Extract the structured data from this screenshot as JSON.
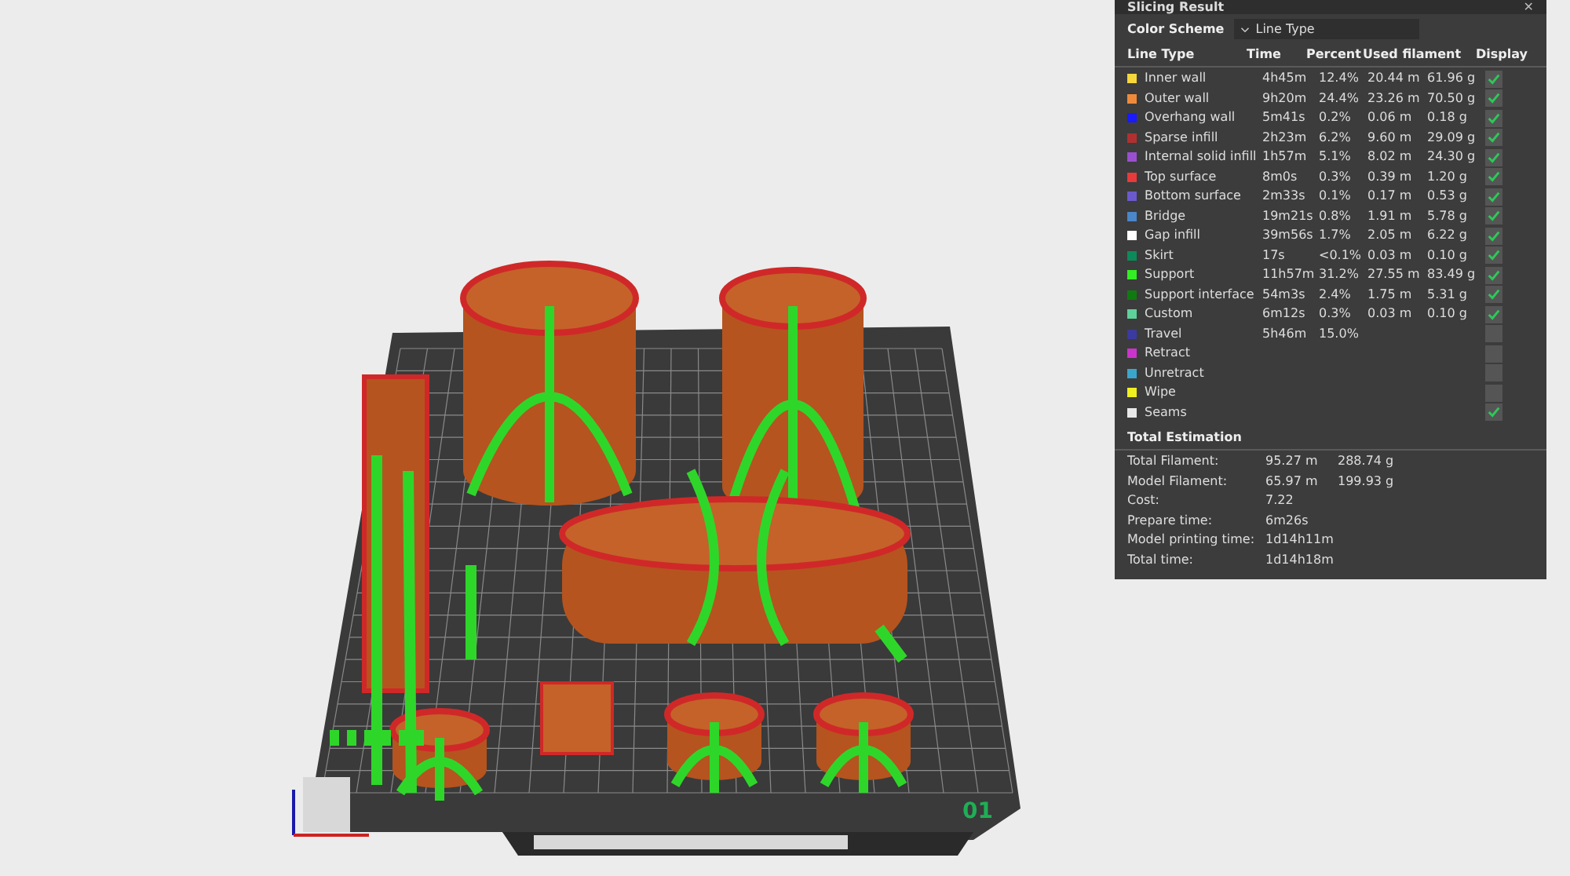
{
  "viewport": {
    "plate_label": "01"
  },
  "panel": {
    "title": "Slicing Result",
    "close": "✕",
    "color_scheme": {
      "label": "Color Scheme",
      "value": "Line Type"
    },
    "columns": [
      "Line Type",
      "Time",
      "Percent",
      "Used filament",
      "Display"
    ],
    "rows": [
      {
        "name": "Inner wall",
        "color": "#f5d63b",
        "time": "4h45m",
        "percent": "12.4%",
        "length": "20.44 m",
        "weight": "61.96 g",
        "checked": true
      },
      {
        "name": "Outer wall",
        "color": "#f08a3b",
        "time": "9h20m",
        "percent": "24.4%",
        "length": "23.26 m",
        "weight": "70.50 g",
        "checked": true
      },
      {
        "name": "Overhang wall",
        "color": "#1a1aff",
        "time": "5m41s",
        "percent": "0.2%",
        "length": "0.06 m",
        "weight": "0.18 g",
        "checked": true
      },
      {
        "name": "Sparse infill",
        "color": "#b03030",
        "time": "2h23m",
        "percent": "6.2%",
        "length": "9.60 m",
        "weight": "29.09 g",
        "checked": true
      },
      {
        "name": "Internal solid infill",
        "color": "#9a4fd0",
        "time": "1h57m",
        "percent": "5.1%",
        "length": "8.02 m",
        "weight": "24.30 g",
        "checked": true
      },
      {
        "name": "Top surface",
        "color": "#e83a3a",
        "time": "8m0s",
        "percent": "0.3%",
        "length": "0.39 m",
        "weight": "1.20 g",
        "checked": true
      },
      {
        "name": "Bottom surface",
        "color": "#6a5acd",
        "time": "2m33s",
        "percent": "0.1%",
        "length": "0.17 m",
        "weight": "0.53 g",
        "checked": true
      },
      {
        "name": "Bridge",
        "color": "#4a86c8",
        "time": "19m21s",
        "percent": "0.8%",
        "length": "1.91 m",
        "weight": "5.78 g",
        "checked": true
      },
      {
        "name": "Gap infill",
        "color": "#ffffff",
        "time": "39m56s",
        "percent": "1.7%",
        "length": "2.05 m",
        "weight": "6.22 g",
        "checked": true
      },
      {
        "name": "Skirt",
        "color": "#0d8a5a",
        "time": "17s",
        "percent": "<0.1%",
        "length": "0.03 m",
        "weight": "0.10 g",
        "checked": true
      },
      {
        "name": "Support",
        "color": "#33ee22",
        "time": "11h57m",
        "percent": "31.2%",
        "length": "27.55 m",
        "weight": "83.49 g",
        "checked": true
      },
      {
        "name": "Support interface",
        "color": "#0f7a10",
        "time": "54m3s",
        "percent": "2.4%",
        "length": "1.75 m",
        "weight": "5.31 g",
        "checked": true
      },
      {
        "name": "Custom",
        "color": "#5ed09a",
        "time": "6m12s",
        "percent": "0.3%",
        "length": "0.03 m",
        "weight": "0.10 g",
        "checked": true
      },
      {
        "name": "Travel",
        "color": "#3a3aa0",
        "time": "5h46m",
        "percent": "15.0%",
        "checked": false
      },
      {
        "name": "Retract",
        "color": "#cc33cc",
        "checked": false
      },
      {
        "name": "Unretract",
        "color": "#3aa6cc",
        "checked": false
      },
      {
        "name": "Wipe",
        "color": "#f0f020",
        "checked": false
      },
      {
        "name": "Seams",
        "color": "#e8e8e8",
        "checked": true
      }
    ],
    "total": {
      "title": "Total Estimation",
      "rows": [
        {
          "label": "Total Filament:",
          "values": [
            "95.27 m",
            "288.74 g"
          ]
        },
        {
          "label": "Model Filament:",
          "values": [
            "65.97 m",
            "199.93 g"
          ]
        },
        {
          "label": "Cost:",
          "values": [
            "7.22"
          ]
        },
        {
          "label": "Prepare time:",
          "values": [
            "6m26s"
          ]
        },
        {
          "label": "Model printing time:",
          "values": [
            "1d14h11m"
          ]
        },
        {
          "label": "Total time:",
          "values": [
            "1d14h18m"
          ]
        }
      ]
    }
  }
}
